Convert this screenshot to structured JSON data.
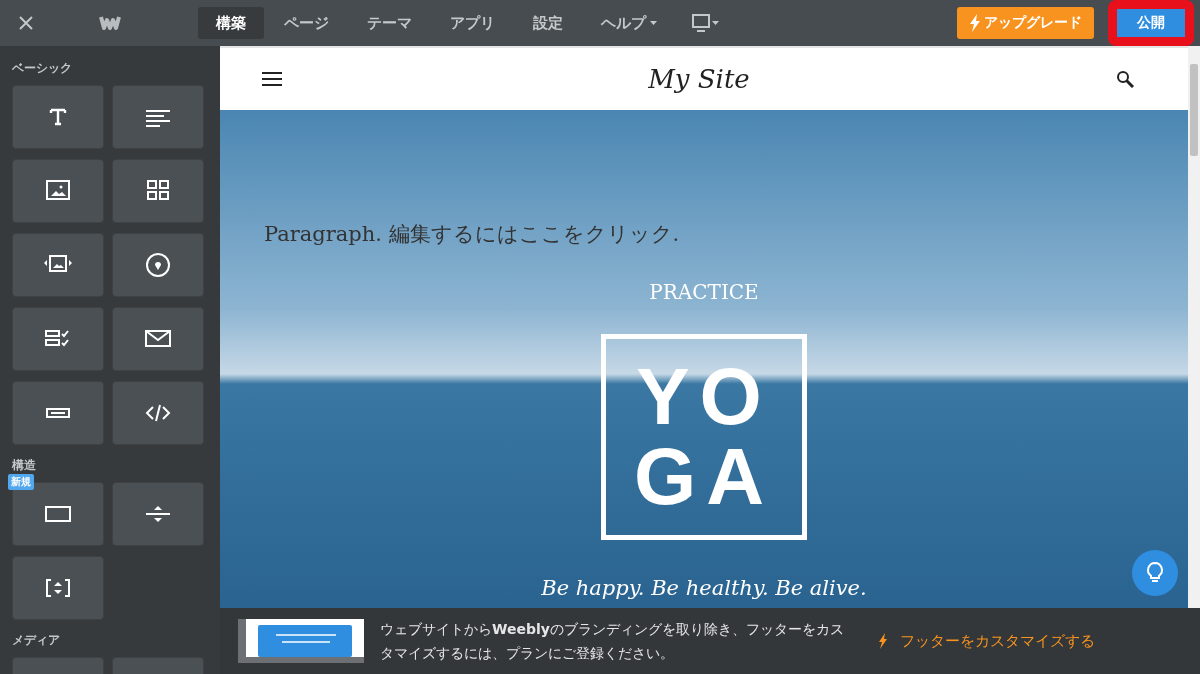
{
  "topbar": {
    "tabs": [
      {
        "label": "構築",
        "selected": true,
        "menu": false
      },
      {
        "label": "ページ",
        "selected": false,
        "menu": false
      },
      {
        "label": "テーマ",
        "selected": false,
        "menu": false
      },
      {
        "label": "アプリ",
        "selected": false,
        "menu": false
      },
      {
        "label": "設定",
        "selected": false,
        "menu": false
      },
      {
        "label": "ヘルプ",
        "selected": false,
        "menu": true
      }
    ],
    "upgrade_button": "アップグレード",
    "publish_button": "公開",
    "publish_highlighted": true
  },
  "sidebar": {
    "sections": [
      {
        "title": "ベーシック",
        "tiles": [
          {
            "kind": "title"
          },
          {
            "kind": "text"
          },
          {
            "kind": "image"
          },
          {
            "kind": "gallery"
          },
          {
            "kind": "slideshow"
          },
          {
            "kind": "map"
          },
          {
            "kind": "form"
          },
          {
            "kind": "contact"
          },
          {
            "kind": "button"
          },
          {
            "kind": "code"
          }
        ]
      },
      {
        "title": "構造",
        "tiles": [
          {
            "kind": "section",
            "badge": "新規"
          },
          {
            "kind": "divider"
          },
          {
            "kind": "spacer"
          }
        ]
      },
      {
        "title": "メディア",
        "tiles": [
          {
            "kind": "media"
          },
          {
            "kind": "media"
          }
        ]
      }
    ]
  },
  "site": {
    "title": "My Site",
    "paragraph": "Paragraph. 編集するにはここをクリック.",
    "kicker": "PRACTICE",
    "logo_lines": [
      "YO",
      "GA"
    ],
    "tagline": "Be happy. Be healthy. Be alive."
  },
  "banner": {
    "message": "ウェブサイトから**Weebly**のブランディングを取り除き、フッターをカスタマイズするには、プランにご登録ください。",
    "link": "フッターをカスタマイズする"
  }
}
